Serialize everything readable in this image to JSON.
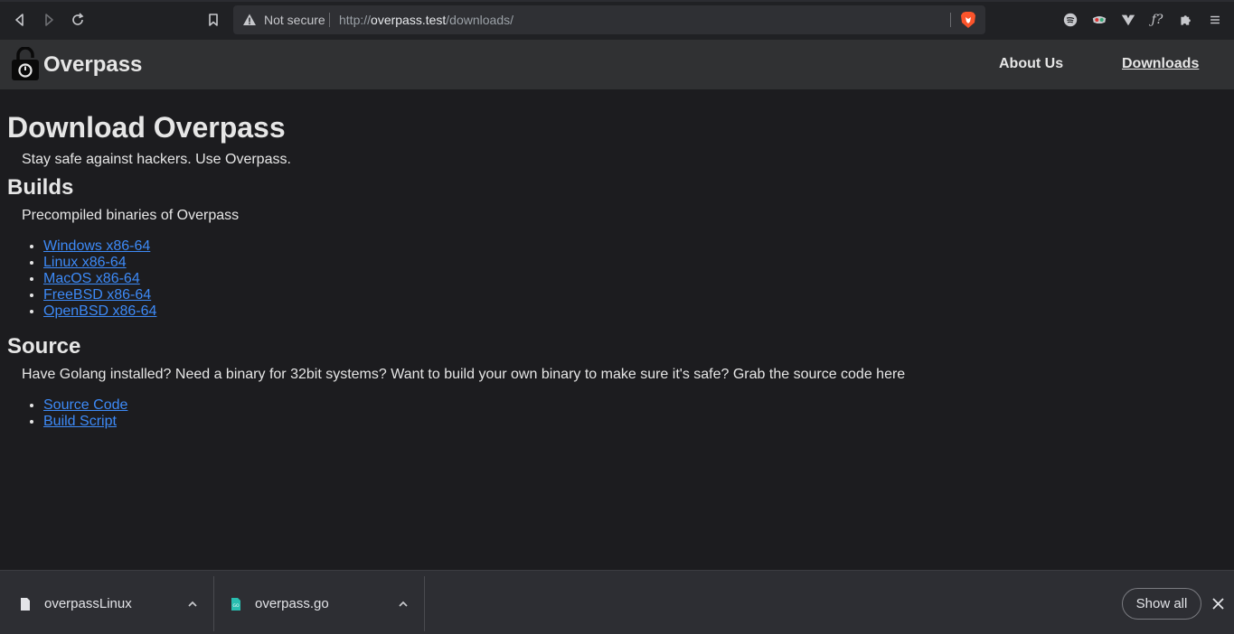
{
  "browser": {
    "security_label": "Not secure",
    "url_scheme": "http://",
    "url_host": "overpass.test",
    "url_path": "/downloads/"
  },
  "site": {
    "brand": "Overpass",
    "nav": {
      "about": "About Us",
      "downloads": "Downloads"
    }
  },
  "page": {
    "title": "Download Overpass",
    "tagline": "Stay safe against hackers. Use Overpass.",
    "builds": {
      "heading": "Builds",
      "description": "Precompiled binaries of Overpass",
      "links": [
        "Windows x86-64",
        "Linux x86-64",
        "MacOS x86-64",
        "FreeBSD x86-64",
        "OpenBSD x86-64"
      ]
    },
    "source": {
      "heading": "Source",
      "description": "Have Golang installed? Need a binary for 32bit systems? Want to build your own binary to make sure it's safe? Grab the source code here",
      "links": [
        "Source Code",
        "Build Script"
      ]
    }
  },
  "downloads_bar": {
    "items": [
      {
        "name": "overpassLinux",
        "icon": "file-icon"
      },
      {
        "name": "overpass.go",
        "icon": "go-file-icon"
      }
    ],
    "show_all": "Show all"
  },
  "colors": {
    "link": "#3d8af7",
    "page_bg": "#1c1c1f",
    "header_bg": "#303133",
    "brave_orange": "#fb542b"
  }
}
